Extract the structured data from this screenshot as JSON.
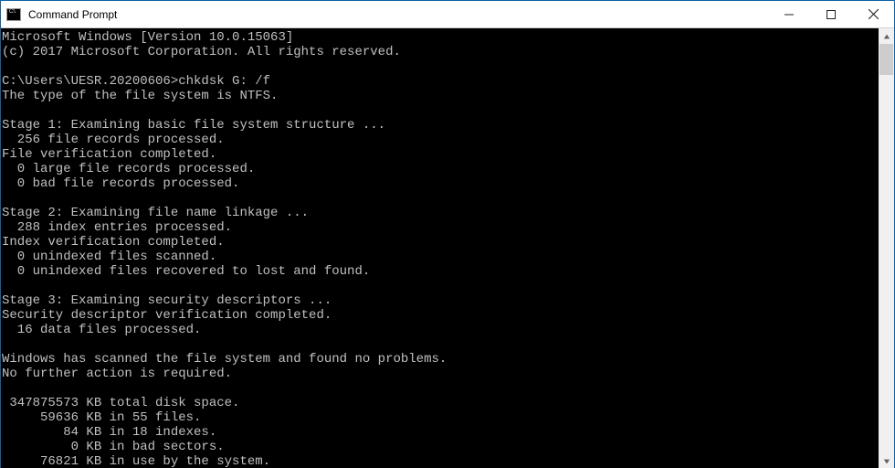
{
  "window": {
    "title": "Command Prompt",
    "icon_glyph": "C:\\."
  },
  "terminal": {
    "lines": [
      "Microsoft Windows [Version 10.0.15063]",
      "(c) 2017 Microsoft Corporation. All rights reserved.",
      "",
      "C:\\Users\\UESR.20200606>chkdsk G: /f",
      "The type of the file system is NTFS.",
      "",
      "Stage 1: Examining basic file system structure ...",
      "  256 file records processed.",
      "File verification completed.",
      "  0 large file records processed.",
      "  0 bad file records processed.",
      "",
      "Stage 2: Examining file name linkage ...",
      "  288 index entries processed.",
      "Index verification completed.",
      "  0 unindexed files scanned.",
      "  0 unindexed files recovered to lost and found.",
      "",
      "Stage 3: Examining security descriptors ...",
      "Security descriptor verification completed.",
      "  16 data files processed.",
      "",
      "Windows has scanned the file system and found no problems.",
      "No further action is required.",
      "",
      " 347875573 KB total disk space.",
      "     59636 KB in 55 files.",
      "        84 KB in 18 indexes.",
      "         0 KB in bad sectors.",
      "     76821 KB in use by the system."
    ]
  }
}
